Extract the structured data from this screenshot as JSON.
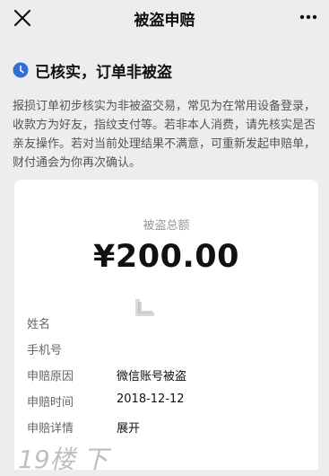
{
  "navbar": {
    "title": "被盗申赔",
    "close_icon": "close-icon",
    "more_icon": "more-icon"
  },
  "status": {
    "icon": "clock-icon",
    "text": "已核实，订单非被盗",
    "icon_color": "#2f6fd6"
  },
  "description": "报损订单初步核实为非被盗交易，常见为在常用设备登录，收款方为好友，指纹支付等。若非本人消费，请先核实是否亲友操作。若对当前处理结果不满意，可重新发起申赔单，财付通会为你再次确认。",
  "card": {
    "amount_label": "被盗总额",
    "amount_value": "¥200.00",
    "rows": [
      {
        "label": "姓名",
        "value": ""
      },
      {
        "label": "手机号",
        "value": ""
      },
      {
        "label": "申赔原因",
        "value": "微信账号被盗"
      },
      {
        "label": "申赔时间",
        "value": "2018-12-12"
      },
      {
        "label": "申赔详情",
        "value": "展开"
      }
    ]
  },
  "watermark": "19楼 下"
}
